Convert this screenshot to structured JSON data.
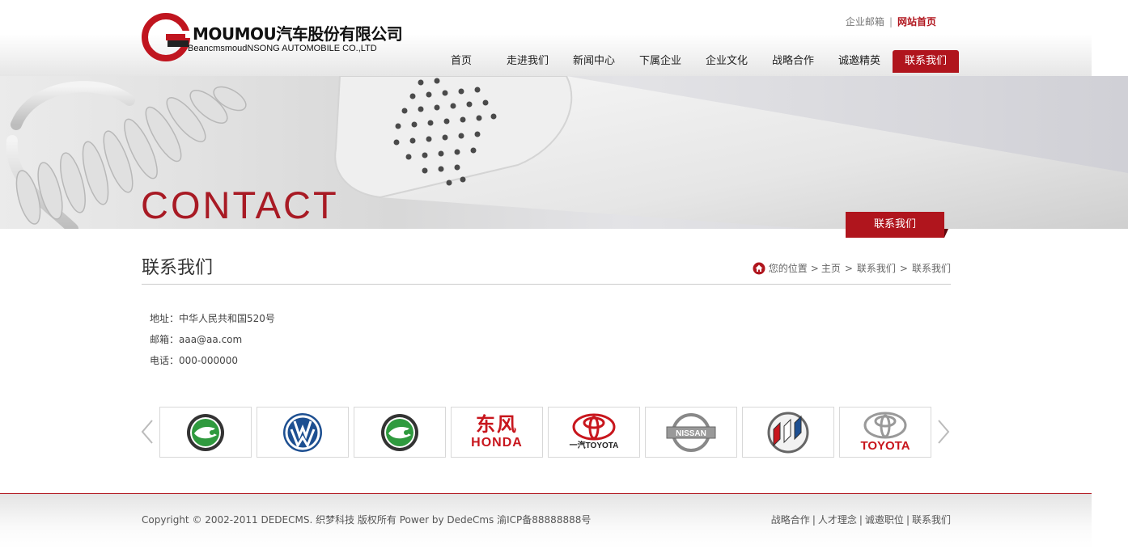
{
  "header": {
    "logo_cn": "MOUMOU汽车股份有限公司",
    "logo_en": "BeancmsmoudNSONG AUTOMOBILE CO.,LTD",
    "top_links": [
      {
        "label": "企业邮箱"
      },
      {
        "label": "网站首页"
      }
    ],
    "nav": [
      {
        "label": "首页"
      },
      {
        "label": "走进我们"
      },
      {
        "label": "新闻中心"
      },
      {
        "label": "下属企业"
      },
      {
        "label": "企业文化"
      },
      {
        "label": "战略合作"
      },
      {
        "label": "诚邀精英"
      },
      {
        "label": "联系我们"
      }
    ],
    "active_nav": "联系我们"
  },
  "banner": {
    "title": "CONTACT",
    "tag": "联系我们"
  },
  "page": {
    "title": "联系我们",
    "breadcrumb": {
      "prefix": "您的位置",
      "items": [
        "主页",
        "联系我们",
        "联系我们"
      ]
    },
    "contact": {
      "address": "地址：中华人民共和国520号",
      "email": "邮箱：aaa@aa.com",
      "phone": "电话：000-000000"
    }
  },
  "partners": [
    {
      "name": "skoda-logo"
    },
    {
      "name": "volkswagen-logo"
    },
    {
      "name": "skoda-logo"
    },
    {
      "name": "dongfeng-honda-logo",
      "cn": "东风",
      "text": "HONDA"
    },
    {
      "name": "faw-toyota-logo",
      "text": "一汽TOYOTA"
    },
    {
      "name": "nissan-logo",
      "text": "NISSAN"
    },
    {
      "name": "buick-logo"
    },
    {
      "name": "toyota-logo",
      "text": "TOYOTA"
    }
  ],
  "footer": {
    "copyright": "Copyright © 2002-2011 DEDECMS. 织梦科技 版权所有 Power by DedeCms 渝ICP备88888888号",
    "links": [
      "战略合作",
      "人才理念",
      "诚邀职位",
      "联系我们"
    ]
  },
  "colors": {
    "brand_red": "#b0151d",
    "text": "#333333"
  }
}
